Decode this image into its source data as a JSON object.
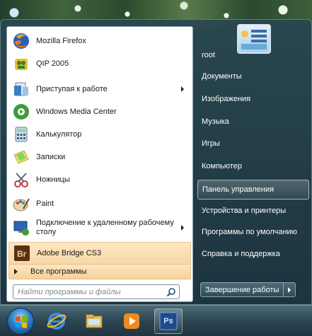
{
  "start_menu": {
    "programs": [
      {
        "label": "Mozilla Firefox",
        "icon": "firefox-icon"
      },
      {
        "label": "QIP 2005",
        "icon": "qip-icon"
      },
      {
        "label": "Приступая к работе",
        "icon": "getting-started-icon",
        "has_submenu": true
      },
      {
        "label": "Windows Media Center",
        "icon": "media-center-icon"
      },
      {
        "label": "Калькулятор",
        "icon": "calculator-icon"
      },
      {
        "label": "Записки",
        "icon": "sticky-notes-icon"
      },
      {
        "label": "Ножницы",
        "icon": "snipping-tool-icon"
      },
      {
        "label": "Paint",
        "icon": "paint-icon"
      },
      {
        "label": "Подключение к удаленному рабочему столу",
        "icon": "remote-desktop-icon",
        "has_submenu": true
      },
      {
        "label": "Adobe Bridge CS3",
        "icon": "adobe-bridge-icon",
        "highlighted": true
      }
    ],
    "all_programs_label": "Все программы",
    "search_placeholder": "Найти программы и файлы",
    "right_items": [
      {
        "label": "root"
      },
      {
        "label": "Документы"
      },
      {
        "label": "Изображения"
      },
      {
        "label": "Музыка"
      },
      {
        "label": "Игры"
      },
      {
        "label": "Компьютер"
      },
      {
        "label": "Панель управления",
        "selected": true
      },
      {
        "label": "Устройства и принтеры"
      },
      {
        "label": "Программы по умолчанию"
      },
      {
        "label": "Справка и поддержка"
      }
    ],
    "shutdown_label": "Завершение работы"
  },
  "taskbar": {
    "buttons": [
      {
        "icon": "internet-explorer-icon"
      },
      {
        "icon": "file-explorer-icon"
      },
      {
        "icon": "media-player-icon"
      },
      {
        "icon": "photoshop-icon",
        "text": "Ps"
      }
    ]
  },
  "colors": {
    "highlight": "#f8d9a8",
    "menu_bg": "#1c3440",
    "accent": "#2f7fc6"
  }
}
